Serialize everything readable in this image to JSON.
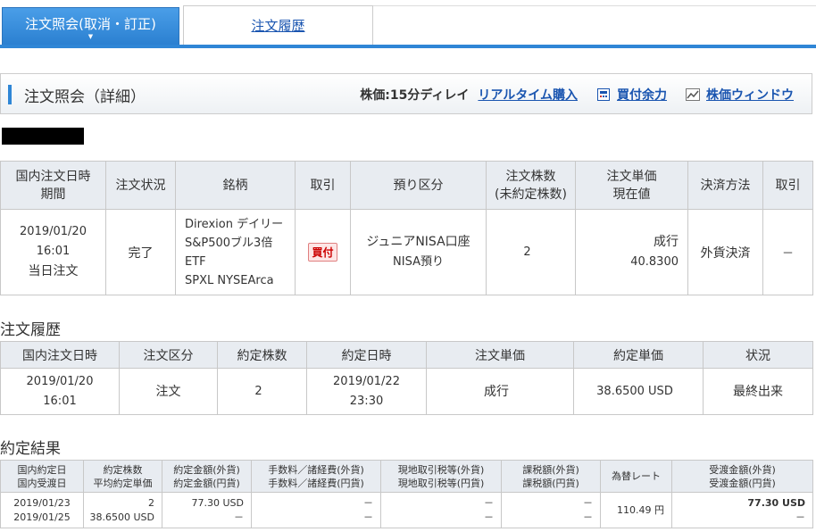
{
  "tabs": {
    "active": "注文照会(取消・訂正)",
    "history": "注文履歴"
  },
  "header": {
    "title": "注文照会（詳細）",
    "delay": "株価:15分ディレイ",
    "realtime_link": "リアルタイム購入",
    "buying_power_link": "買付余力",
    "price_window_link": "株価ウィンドウ"
  },
  "detail": {
    "headers": {
      "datetime_1": "国内注文日時",
      "datetime_2": "期間",
      "status": "注文状況",
      "stock": "銘柄",
      "trade": "取引",
      "account": "預り区分",
      "qty_1": "注文株数",
      "qty_2": "(未約定株数)",
      "price_1": "注文単価",
      "price_2": "現在値",
      "settle": "決済方法",
      "cancel": "取引"
    },
    "row": {
      "date": "2019/01/20",
      "time": "16:01",
      "period": "当日注文",
      "status": "完了",
      "stock_1": "Direxion デイリー",
      "stock_2": "S&P500ブル3倍",
      "stock_3": "ETF",
      "stock_4": "SPXL NYSEArca",
      "trade": "買付",
      "account_1": "ジュニアNISA口座",
      "account_2": "NISA預り",
      "qty": "2",
      "order_type": "成行",
      "current": "40.8300",
      "settle": "外貨決済",
      "cancel": "－"
    }
  },
  "history": {
    "title": "注文履歴",
    "headers": [
      "国内注文日時",
      "注文区分",
      "約定株数",
      "約定日時",
      "注文単価",
      "約定単価",
      "状況"
    ],
    "row": {
      "date": "2019/01/20",
      "time": "16:01",
      "kind": "注文",
      "qty": "2",
      "exec_date": "2019/01/22",
      "exec_time": "23:30",
      "order_price": "成行",
      "exec_price": "38.6500 USD",
      "status": "最終出来"
    }
  },
  "result": {
    "title": "約定結果",
    "headers": {
      "h1a": "国内約定日",
      "h1b": "国内受渡日",
      "h2a": "約定株数",
      "h2b": "平均約定単価",
      "h3a": "約定金額(外貨)",
      "h3b": "約定金額(円貨)",
      "h4a": "手数料／諸経費(外貨)",
      "h4b": "手数料／諸経費(円貨)",
      "h5a": "現地取引税等(外貨)",
      "h5b": "現地取引税等(円貨)",
      "h6a": "課税額(外貨)",
      "h6b": "課税額(円貨)",
      "h7": "為替レート",
      "h8a": "受渡金額(外貨)",
      "h8b": "受渡金額(円貨)"
    },
    "row": {
      "exec_date": "2019/01/23",
      "settle_date": "2019/01/25",
      "qty": "2",
      "avg_price": "38.6500 USD",
      "amount_fx": "77.30 USD",
      "amount_jpy": "－",
      "fee_fx": "－",
      "fee_jpy": "－",
      "tax_fx": "－",
      "tax_jpy": "－",
      "taxable_fx": "－",
      "taxable_jpy": "－",
      "rate": "110.49 円",
      "delivery_fx": "77.30 USD",
      "delivery_jpy": "－"
    }
  }
}
